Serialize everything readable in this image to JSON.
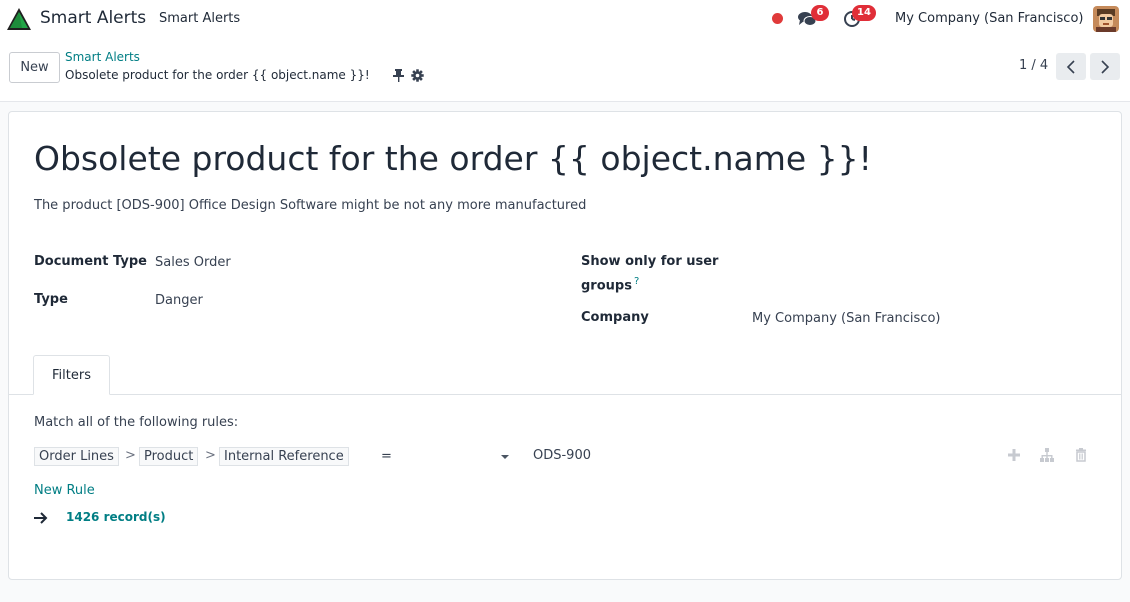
{
  "topnav": {
    "app_name": "Smart Alerts",
    "menu_link": "Smart Alerts",
    "messages_count": "6",
    "activities_count": "14",
    "company": "My Company (San Francisco)"
  },
  "control": {
    "new_label": "New",
    "breadcrumb_parent": "Smart Alerts",
    "breadcrumb_current": "Obsolete product for the order {{ object.name }}!",
    "pager": "1 / 4"
  },
  "form": {
    "title": "Obsolete product for the order {{ object.name }}!",
    "description": "The product [ODS-900] Office Design Software might be not any more manufactured",
    "document_type_label": "Document Type",
    "document_type_value": "Sales Order",
    "type_label": "Type",
    "type_value": "Danger",
    "groups_label_line1": "Show only for user",
    "groups_label_line2": "groups",
    "groups_help": "?",
    "company_label": "Company",
    "company_value": "My Company (San Francisco)"
  },
  "filters": {
    "tab_label": "Filters",
    "match_text": "Match all of the following rules:",
    "path": [
      "Order Lines",
      "Product",
      "Internal Reference"
    ],
    "separator": ">",
    "operator": "=",
    "value": "ODS-900",
    "new_rule": "New Rule",
    "records": "1426 record(s)"
  },
  "colors": {
    "accent": "#017e84",
    "badge": "#e02e38",
    "recording": "#e03a3a"
  },
  "icons": {
    "logo": "triangle-logo-icon",
    "chat": "chat-icon",
    "activity": "clock-icon",
    "pin": "pin-icon",
    "gear": "gear-icon",
    "add": "plus-icon",
    "branch": "hierarchy-icon",
    "delete": "trash-icon",
    "arrow": "arrow-right-icon"
  }
}
